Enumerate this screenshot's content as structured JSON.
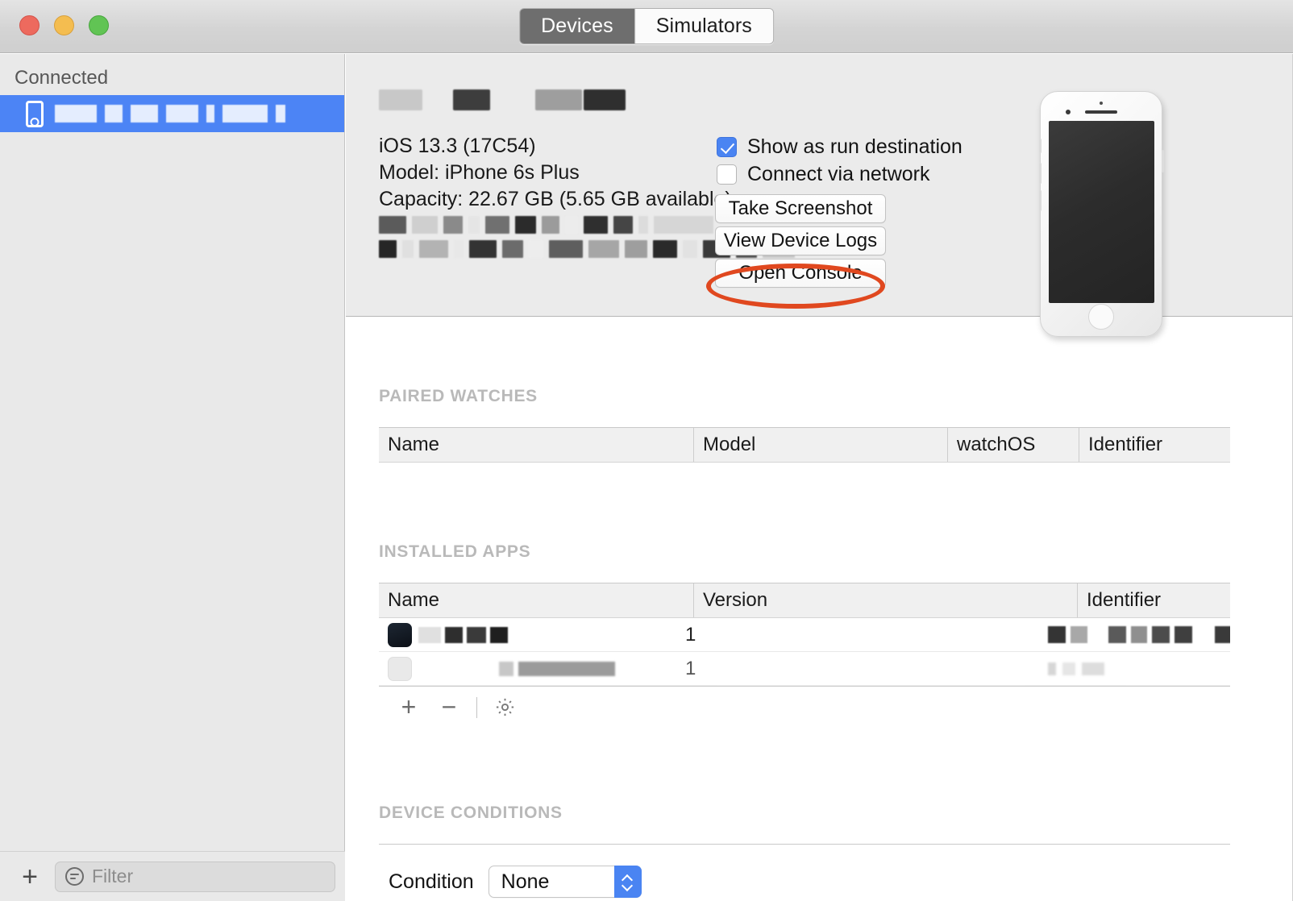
{
  "window": {
    "traffic_lights": [
      "close",
      "minimize",
      "zoom"
    ],
    "colors": {
      "close": "#ed6a5e",
      "minimize": "#f4bd50",
      "zoom": "#61c454",
      "selection_blue": "#4c84f5",
      "accent_blue": "#4a84f2",
      "annotation_orange": "#e0481f"
    }
  },
  "toolbar": {
    "tabs": [
      {
        "label": "Devices",
        "selected": true
      },
      {
        "label": "Simulators",
        "selected": false
      }
    ]
  },
  "sidebar": {
    "header": "Connected",
    "items": [
      {
        "label": "",
        "redacted": true,
        "icon": "iphone-icon",
        "selected": true
      }
    ],
    "add_button": "+",
    "filter": {
      "placeholder": "Filter",
      "value": "",
      "icon": "filter-icon"
    }
  },
  "device": {
    "name": "",
    "name_redacted": true,
    "os": "iOS 13.3 (17C54)",
    "model": "Model: iPhone 6s Plus",
    "capacity": "Capacity: 22.67 GB (5.65 GB available)",
    "extra_line_1": "",
    "extra_line_2": "",
    "options": [
      {
        "label": "Show as run destination",
        "checked": true
      },
      {
        "label": "Connect via network",
        "checked": false
      }
    ],
    "buttons": [
      {
        "label": "Take Screenshot",
        "annotated": false
      },
      {
        "label": "View Device Logs",
        "annotated": true
      },
      {
        "label": "Open Console",
        "annotated": false
      }
    ],
    "illustration": "iphone-6s-plus-silver"
  },
  "paired_watches": {
    "title": "PAIRED WATCHES",
    "columns": [
      "Name",
      "Model",
      "watchOS",
      "Identifier"
    ],
    "rows": []
  },
  "installed_apps": {
    "title": "INSTALLED APPS",
    "columns": [
      "Name",
      "Version",
      "Identifier"
    ],
    "rows": [
      {
        "name": "",
        "name_redacted": true,
        "version": "1",
        "identifier": "",
        "identifier_redacted": true,
        "icon": "app-icon-dark"
      },
      {
        "name": "Runner Runner",
        "name_redacted": true,
        "version": "1",
        "identifier": "",
        "identifier_redacted": true,
        "icon": "app-icon-light"
      }
    ],
    "toolbar": [
      {
        "name": "add",
        "glyph": "+"
      },
      {
        "name": "remove",
        "glyph": "−"
      },
      {
        "name": "settings",
        "glyph": "gear"
      }
    ]
  },
  "device_conditions": {
    "title": "DEVICE CONDITIONS",
    "condition_label": "Condition",
    "condition_value": "None",
    "condition_options": [
      "None"
    ]
  }
}
